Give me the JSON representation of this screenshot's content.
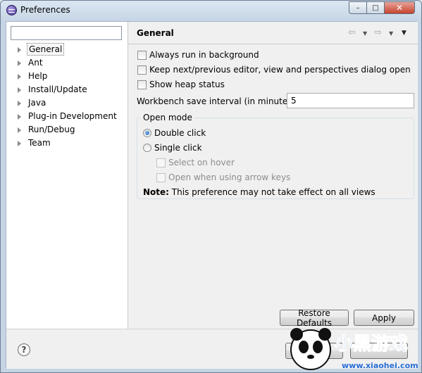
{
  "window": {
    "title": "Preferences",
    "min_symbol": "–",
    "max_symbol": "□",
    "close_symbol": "✕"
  },
  "sidebar": {
    "filter_value": "",
    "items": [
      {
        "label": "General",
        "selected": true
      },
      {
        "label": "Ant"
      },
      {
        "label": "Help"
      },
      {
        "label": "Install/Update"
      },
      {
        "label": "Java"
      },
      {
        "label": "Plug-in Development"
      },
      {
        "label": "Run/Debug"
      },
      {
        "label": "Team"
      }
    ]
  },
  "page": {
    "title": "General",
    "nav_back_symbol": "⇦",
    "nav_forward_symbol": "⇨",
    "dropdown_symbol": "▼",
    "options": {
      "always_run_in_background": "Always run in background",
      "keep_next_previous": "Keep next/previous editor, view and perspectives dialog open",
      "show_heap_status": "Show heap status"
    },
    "interval_label": "Workbench save interval (in minutes):",
    "interval_value": "5",
    "open_mode": {
      "title": "Open mode",
      "double_click": "Double click",
      "single_click": "Single click",
      "select_on_hover": "Select on hover",
      "open_with_arrow_keys": "Open when using arrow keys",
      "selected": "Double click"
    },
    "note_label": "Note:",
    "note_text": " This preference may not take effect on all views",
    "restore_defaults": "Restore Defaults",
    "apply": "Apply"
  },
  "footer": {
    "help_symbol": "?"
  },
  "watermark": {
    "brand_text": "小黑游戏",
    "site": "www.xiaohei.com"
  }
}
